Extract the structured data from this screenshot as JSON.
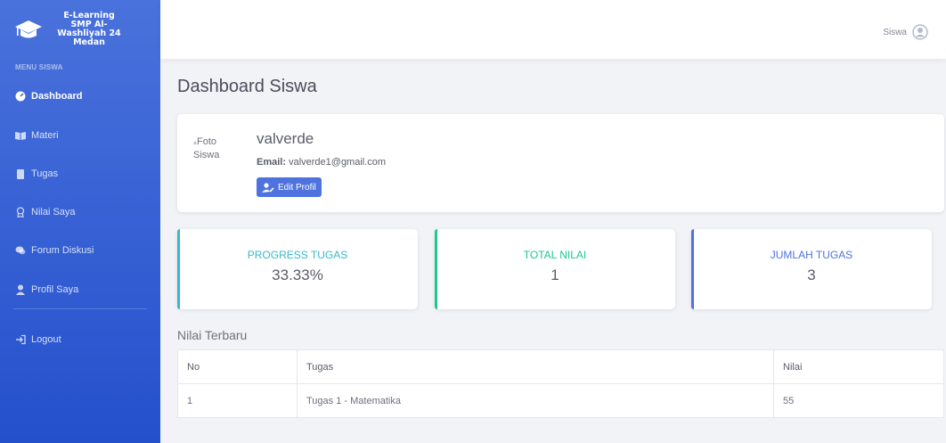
{
  "brand": {
    "line1": "E-Learning",
    "line2": "SMP Al-",
    "line3": "Washliyah 24",
    "line4": "Medan"
  },
  "sidebar": {
    "heading": "MENU SISWA",
    "items": [
      {
        "label": "Dashboard",
        "icon": "dashboard-icon"
      },
      {
        "label": "Materi",
        "icon": "book-icon"
      },
      {
        "label": "Tugas",
        "icon": "clipboard-icon"
      },
      {
        "label": "Nilai Saya",
        "icon": "award-icon"
      },
      {
        "label": "Forum Diskusi",
        "icon": "comments-icon"
      },
      {
        "label": "Profil Saya",
        "icon": "user-icon"
      },
      {
        "label": "Logout",
        "icon": "logout-icon"
      }
    ]
  },
  "topbar": {
    "user_label": "Siswa"
  },
  "page": {
    "title": "Dashboard Siswa"
  },
  "profile": {
    "photo_alt_1": "Foto",
    "photo_alt_2": "Siswa",
    "name": "valverde",
    "email_label": "Email:",
    "email": "valverde1@gmail.com",
    "edit_label": "Edit Profil"
  },
  "stats": [
    {
      "label": "PROGRESS TUGAS",
      "value": "33.33%",
      "color": "#36b9cc"
    },
    {
      "label": "TOTAL NILAI",
      "value": "1",
      "color": "#1cc88a"
    },
    {
      "label": "JUMLAH TUGAS",
      "value": "3",
      "color": "#4e73df"
    }
  ],
  "grades": {
    "title": "Nilai Terbaru",
    "headers": [
      "No",
      "Tugas",
      "Nilai"
    ],
    "rows": [
      [
        "1",
        "Tugas 1 - Matematika",
        "55"
      ]
    ]
  },
  "colors": {
    "sidebar": "#3a60d6",
    "primary": "#4e73df"
  }
}
